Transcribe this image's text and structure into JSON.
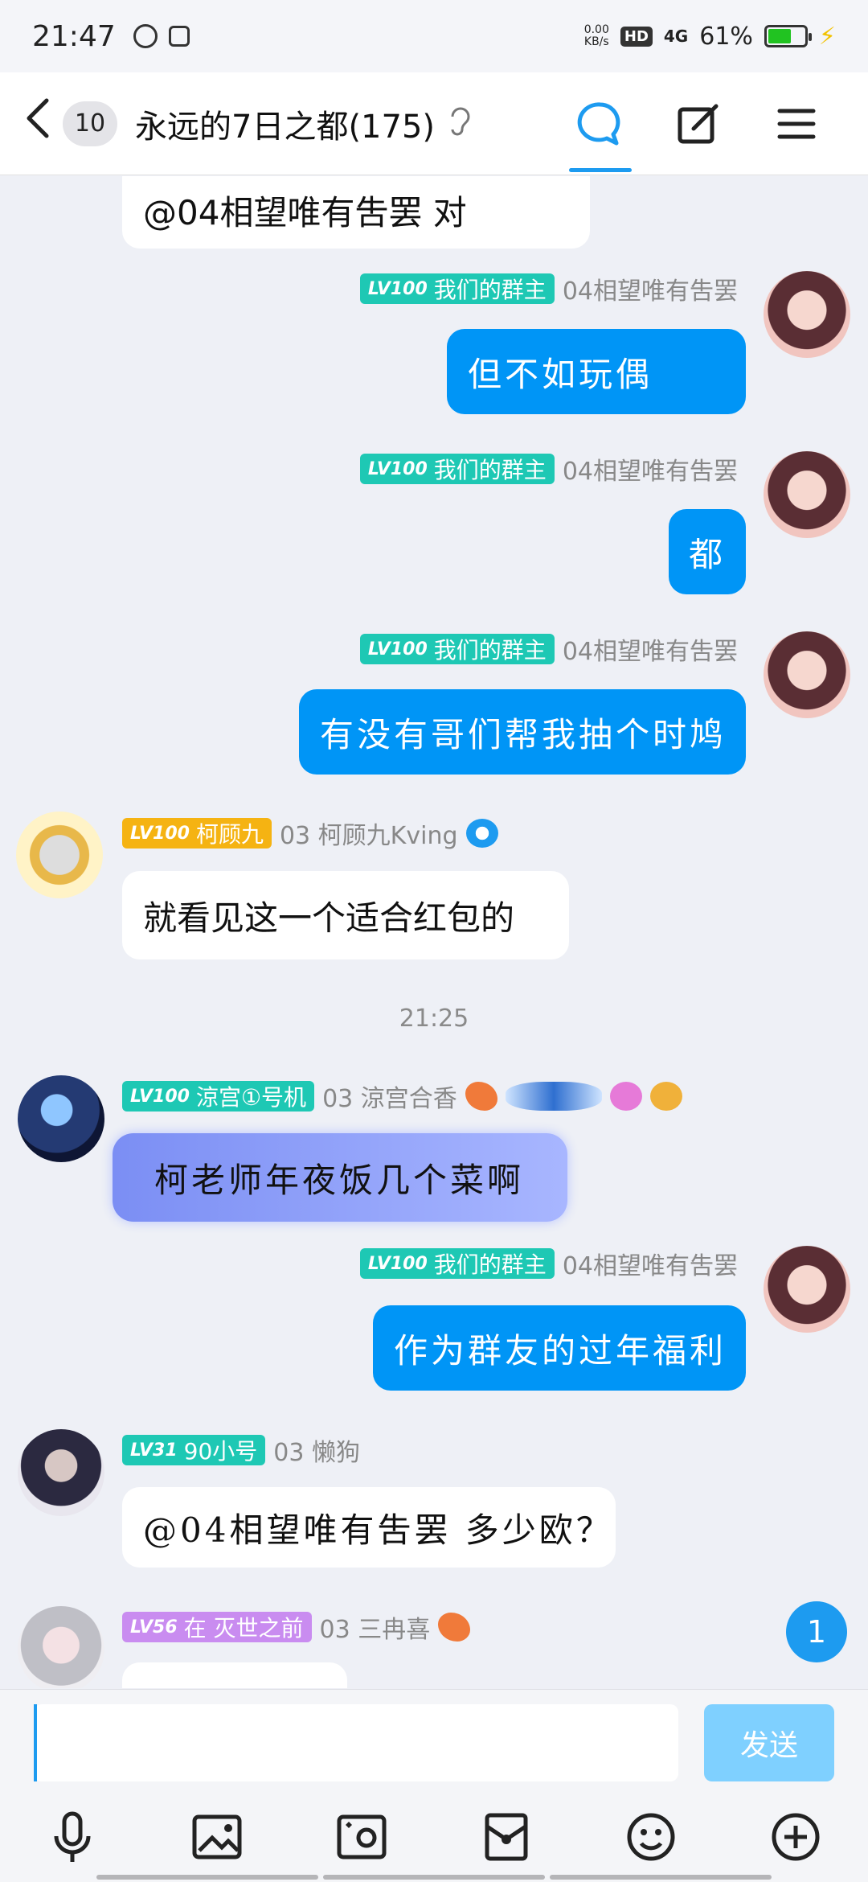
{
  "status_bar": {
    "time": "21:47",
    "net_speed_top": "0.00",
    "net_speed_unit": "KB/s",
    "hd": "HD",
    "signal": "4G",
    "battery": "61%",
    "battery_level": 0.61
  },
  "header": {
    "back_count": "10",
    "title": "永远的7日之都(175)"
  },
  "chat": {
    "partial_top": {
      "text": "@04相望唯有吿罢 对"
    },
    "messages": [
      {
        "tag_level": "LV100",
        "tag_title": "我们的群主",
        "nick": "04相望唯有吿罢",
        "text": "但不如玩偶"
      },
      {
        "tag_level": "LV100",
        "tag_title": "我们的群主",
        "nick": "04相望唯有吿罢",
        "text": "都"
      },
      {
        "tag_level": "LV100",
        "tag_title": "我们的群主",
        "nick": "04相望唯有吿罢",
        "text": "有没有哥们帮我抽个时鸠"
      },
      {
        "tag_level": "LV100",
        "tag_title": "柯顾九",
        "nick": "03 柯顾九Kving",
        "text": "就看见这一个适合红包的"
      },
      {
        "tag_level": "LV100",
        "tag_title": "涼宫①号机",
        "nick": "03 涼宫合香",
        "text": "柯老师年夜饭几个菜啊"
      },
      {
        "tag_level": "LV100",
        "tag_title": "我们的群主",
        "nick": "04相望唯有吿罢",
        "text": "作为群友的过年福利"
      },
      {
        "tag_level": "LV31",
        "tag_title": "90小号",
        "nick": "03 懒狗",
        "text": "@04相望唯有吿罢 多少欧？"
      },
      {
        "tag_level": "LV56",
        "tag_title": "在 灭世之前",
        "nick": "03 三冉喜",
        "text": ""
      }
    ],
    "timestamp": "21:25",
    "unread_count": "1"
  },
  "input_bar": {
    "placeholder": "",
    "send_label": "发送"
  },
  "colors": {
    "accent": "#0095f6",
    "owner_tag": "#1ec8b4",
    "gold_tag": "#f5b312",
    "purple_tag": "#c98cf0"
  }
}
